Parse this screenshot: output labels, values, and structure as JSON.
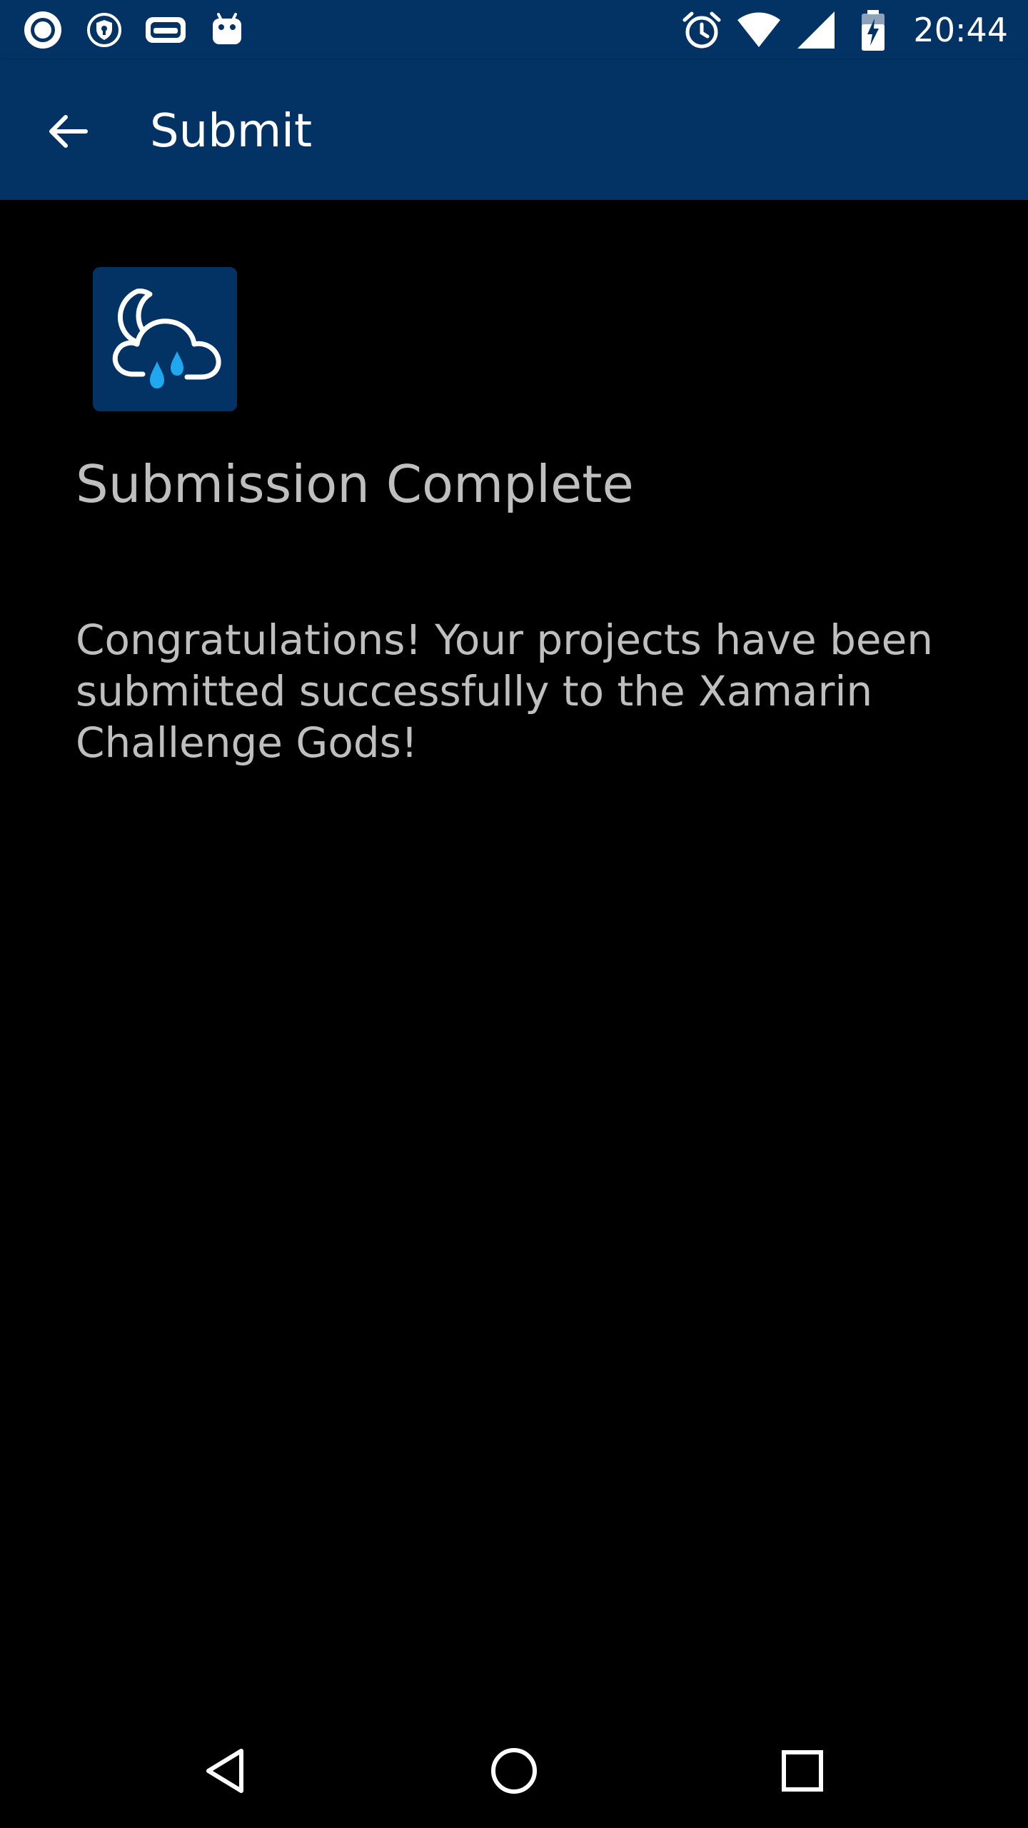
{
  "status_bar": {
    "time": "20:44",
    "left_icons": [
      "record-icon",
      "vpn-shield-icon",
      "game-controller-icon",
      "android-icon"
    ],
    "right_icons": [
      "alarm-icon",
      "wifi-icon",
      "cellular-signal-icon",
      "battery-charging-icon"
    ]
  },
  "app_bar": {
    "title": "Submit",
    "background": "#023364"
  },
  "content": {
    "logo_icon": "weather-cloud-rain-icon",
    "heading": "Submission Complete",
    "message": "Congratulations! Your projects have been submitted successfully to the Xamarin Challenge Gods!"
  },
  "nav_bar": {
    "buttons": [
      "back-nav-icon",
      "home-nav-icon",
      "recents-nav-icon"
    ]
  },
  "colors": {
    "primary": "#023364",
    "accent": "#1fa7f0",
    "text": "#bfbfbf",
    "background": "#000000"
  }
}
